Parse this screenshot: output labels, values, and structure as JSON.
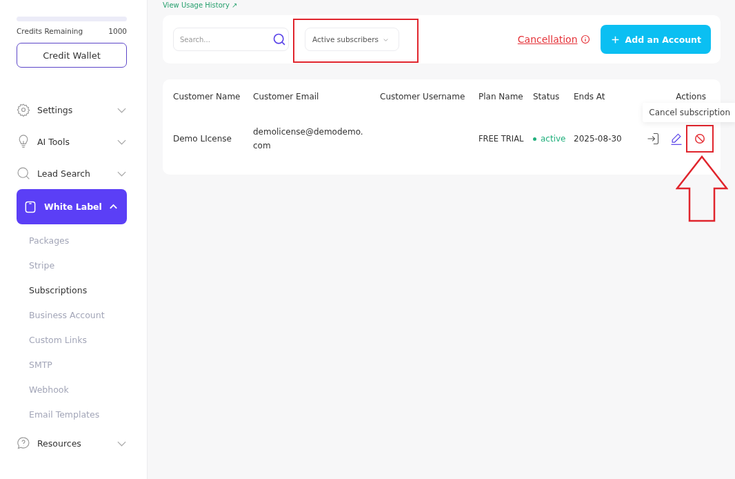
{
  "sidebar": {
    "credits": {
      "label": "Credits Remaining",
      "value": "1000"
    },
    "wallet_button": "Credit Wallet",
    "items": [
      {
        "label": "Settings",
        "kind": "gear",
        "expanded": false,
        "selected": false
      },
      {
        "label": "AI Tools",
        "kind": "bulb",
        "expanded": false,
        "selected": false
      },
      {
        "label": "Lead Search",
        "kind": "search",
        "expanded": false,
        "selected": false
      },
      {
        "label": "White Label",
        "kind": "square",
        "expanded": true,
        "selected": true,
        "children": [
          {
            "label": "Packages",
            "selected": false
          },
          {
            "label": "Stripe",
            "selected": false
          },
          {
            "label": "Subscriptions",
            "selected": true
          },
          {
            "label": "Business Account",
            "selected": false
          },
          {
            "label": "Custom Links",
            "selected": false
          },
          {
            "label": "SMTP",
            "selected": false
          },
          {
            "label": "Webhook",
            "selected": false
          },
          {
            "label": "Email Templates",
            "selected": false
          }
        ]
      },
      {
        "label": "Resources",
        "kind": "help",
        "expanded": false,
        "selected": false
      }
    ]
  },
  "usage_link": "View Usage History ↗",
  "toolbar": {
    "search": {
      "placeholder": "Search..."
    },
    "filter": {
      "value": "Active subscribers",
      "highlighted": true
    },
    "cancellation_link": "Cancellation",
    "add_button": "Add an Account"
  },
  "table": {
    "columns": [
      "Customer Name",
      "Customer Email",
      "Customer Username",
      "Plan Name",
      "Status",
      "Ends At",
      "Actions"
    ],
    "rows": [
      {
        "name": "Demo LIcense",
        "email": "demolicense@demodemo.\ncom",
        "plan": "FREE TRIAL",
        "status": "active",
        "ends": "2025-08-30",
        "actions": [
          {
            "kind": "login",
            "highlighted": false
          },
          {
            "kind": "edit",
            "highlighted": false
          },
          {
            "kind": "cancel",
            "highlighted": true,
            "tooltip": "Cancel subscription"
          }
        ]
      }
    ]
  },
  "pointer_arrow": true
}
